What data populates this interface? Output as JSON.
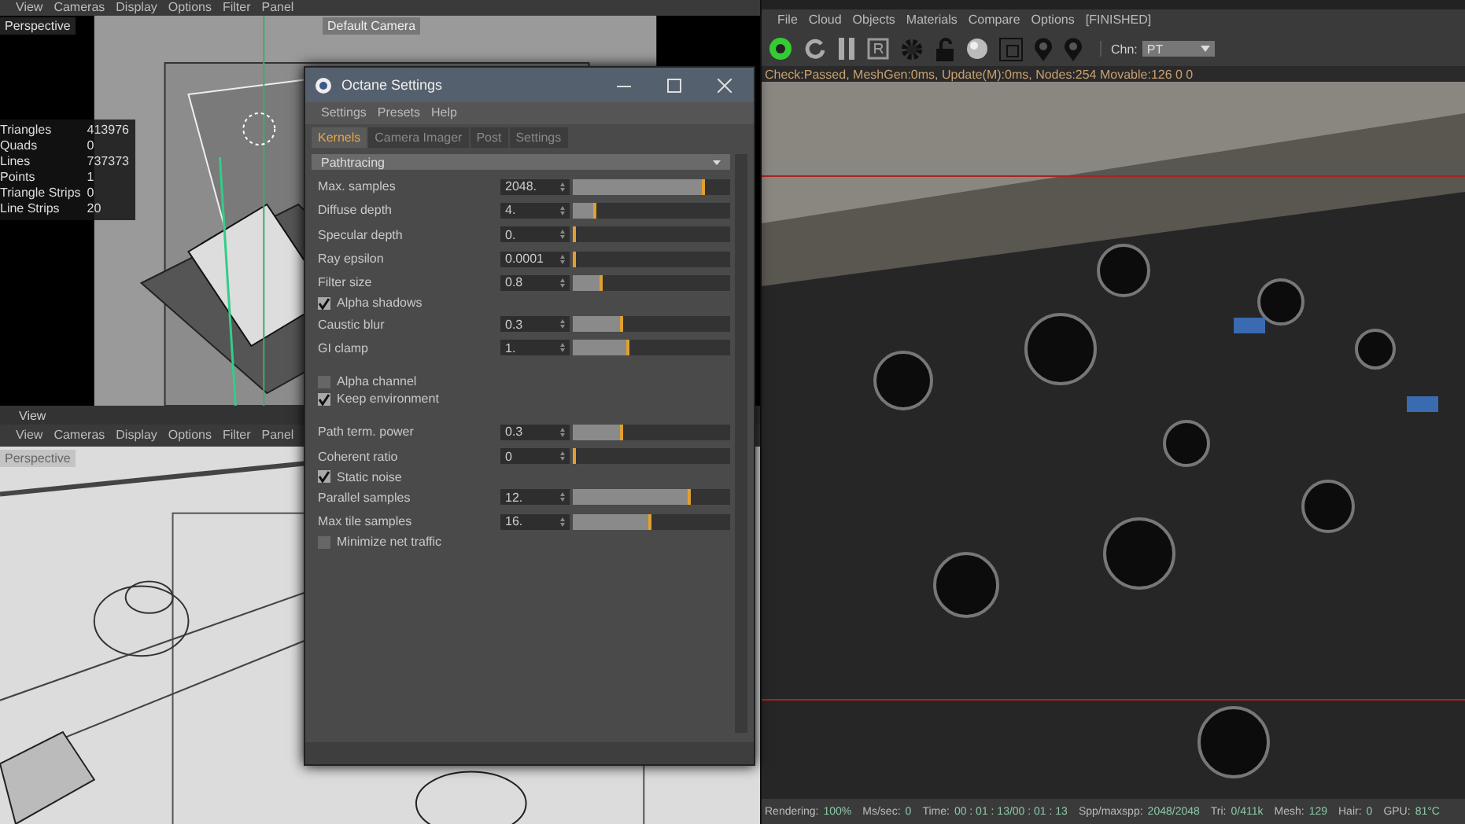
{
  "top_viewport": {
    "menu": [
      "View",
      "Cameras",
      "Display",
      "Options",
      "Filter",
      "Panel"
    ],
    "view_label": "Perspective",
    "camera_label": "Default Camera",
    "stats": [
      {
        "label": "Triangles",
        "value": "413976"
      },
      {
        "label": "Quads",
        "value": "0"
      },
      {
        "label": "Lines",
        "value": "737373"
      },
      {
        "label": "Points",
        "value": "1"
      },
      {
        "label": "Triangle Strips",
        "value": "0"
      },
      {
        "label": "Line Strips",
        "value": "20"
      }
    ]
  },
  "bottom_viewport": {
    "title": "View",
    "menu": [
      "View",
      "Cameras",
      "Display",
      "Options",
      "Filter",
      "Panel"
    ],
    "view_label": "Perspective"
  },
  "octane_settings": {
    "title": "Octane Settings",
    "menu": [
      "Settings",
      "Presets",
      "Help"
    ],
    "tabs": [
      {
        "label": "Kernels",
        "selected": true
      },
      {
        "label": "Camera Imager",
        "selected": false
      },
      {
        "label": "Post",
        "selected": false
      },
      {
        "label": "Settings",
        "selected": false
      }
    ],
    "kernel": "Pathtracing",
    "rows": [
      {
        "kind": "slider",
        "label": "Max. samples",
        "value": "2048.",
        "level": 0.82
      },
      {
        "kind": "slider",
        "label": "Diffuse depth",
        "value": "4.",
        "level": 0.13
      },
      {
        "kind": "slider",
        "label": "Specular depth",
        "value": "0.",
        "level": 0
      },
      {
        "kind": "slider",
        "label": "Ray epsilon",
        "value": "0.0001",
        "level": 0
      },
      {
        "kind": "slider",
        "label": "Filter size",
        "value": "0.8",
        "level": 0.17
      },
      {
        "kind": "checkbox",
        "label": "Alpha shadows",
        "checked": true
      },
      {
        "kind": "slider",
        "label": "Caustic blur",
        "value": "0.3",
        "level": 0.3
      },
      {
        "kind": "slider",
        "label": "GI clamp",
        "value": "1.",
        "level": 0.34
      },
      {
        "kind": "separator"
      },
      {
        "kind": "checkbox",
        "label": "Alpha channel",
        "checked": false
      },
      {
        "kind": "checkbox",
        "label": "Keep environment",
        "checked": true
      },
      {
        "kind": "separator"
      },
      {
        "kind": "slider",
        "label": "Path term. power",
        "value": "0.3",
        "level": 0.3
      },
      {
        "kind": "slider",
        "label": "Coherent ratio",
        "value": "0",
        "level": 0
      },
      {
        "kind": "checkbox",
        "label": "Static noise",
        "checked": true
      },
      {
        "kind": "slider",
        "label": "Parallel samples",
        "value": "12.",
        "level": 0.73
      },
      {
        "kind": "slider",
        "label": "Max tile samples",
        "value": "16.",
        "level": 0.48
      },
      {
        "kind": "checkbox",
        "label": "Minimize net traffic",
        "checked": false
      }
    ]
  },
  "live_viewer": {
    "menu": [
      "File",
      "Cloud",
      "Objects",
      "Materials",
      "Compare",
      "Options"
    ],
    "state": "[FINISHED]",
    "channel_label": "Chn:",
    "channel": "PT",
    "check_line": "Check:Passed, MeshGen:0ms, Update(M):0ms, Nodes:254 Movable:126 0 0",
    "status": [
      {
        "label": "Rendering:",
        "value": "100%"
      },
      {
        "label": "Ms/sec:",
        "value": "0"
      },
      {
        "label": "Time:",
        "value": "00 : 01 : 13/00 : 01 : 13"
      },
      {
        "label": "Spp/maxspp:",
        "value": "2048/2048"
      },
      {
        "label": "Tri:",
        "value": "0/411k"
      },
      {
        "label": "Mesh:",
        "value": "129"
      },
      {
        "label": "Hair:",
        "value": "0"
      },
      {
        "label": "GPU:",
        "value": "81°C"
      }
    ]
  }
}
